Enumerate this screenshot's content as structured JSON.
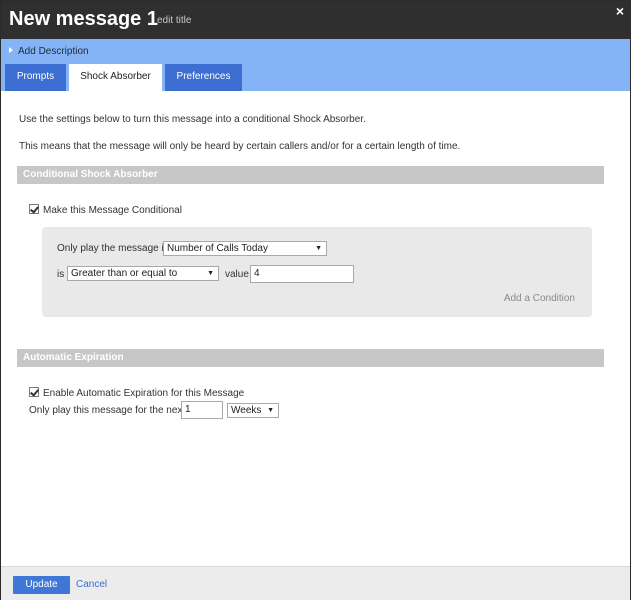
{
  "window": {
    "title": "New message 1",
    "edit_title_label": "edit title",
    "close_label": "×"
  },
  "description": {
    "add_label": "Add Description"
  },
  "tabs": [
    {
      "label": "Prompts",
      "active": false
    },
    {
      "label": "Shock Absorber",
      "active": true
    },
    {
      "label": "Preferences",
      "active": false
    }
  ],
  "intro": {
    "line1": "Use the settings below to turn this message into a conditional Shock Absorber.",
    "line2": "This means that the message will only be heard by certain callers and/or for a certain length of time."
  },
  "conditional": {
    "section_title": "Conditional Shock Absorber",
    "checkbox_label": "Make this Message Conditional",
    "checked": true,
    "only_play_label": "Only play the message if",
    "field_select": "Number of Calls Today",
    "is_label": "is",
    "operator_select": "Greater than or equal to",
    "value_label": "value",
    "value_input": "4",
    "add_condition_label": "Add a Condition"
  },
  "expiration": {
    "section_title": "Automatic Expiration",
    "checkbox_label": "Enable Automatic Expiration for this Message",
    "checked": true,
    "only_play_label": "Only play this message for the next",
    "amount_input": "1",
    "unit_select": "Weeks"
  },
  "footer": {
    "update_label": "Update",
    "cancel_label": "Cancel"
  },
  "colors": {
    "titlebar": "#2f2f2f",
    "description_bar": "#84b4f5",
    "tab_dark": "#3c6fd1",
    "section_bar": "#c7c7c7",
    "button_primary": "#3f77d6"
  }
}
